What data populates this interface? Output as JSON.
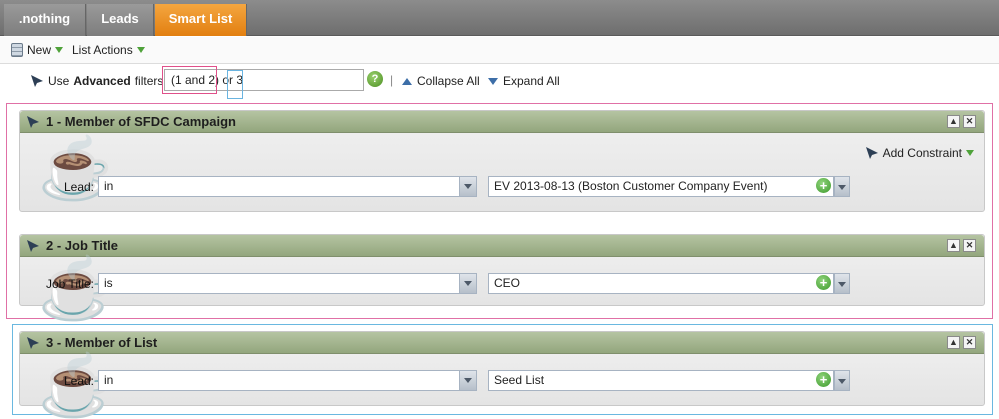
{
  "tabs": [
    {
      "label": ".nothing"
    },
    {
      "label": "Leads"
    },
    {
      "label": "Smart List"
    }
  ],
  "toolbar": {
    "new_label": "New",
    "list_actions_label": "List Actions"
  },
  "logic": {
    "use_prefix": "Use ",
    "use_bold": "Advanced",
    "use_suffix": " filters",
    "expression_part1": "(1 and 2)",
    "expression_part2": " or ",
    "expression_part3": "3",
    "help_symbol": "?",
    "separator": "|",
    "collapse_all": "Collapse All",
    "expand_all": "Expand All"
  },
  "filters": [
    {
      "title": "1 - Member of SFDC Campaign",
      "add_constraint": "Add Constraint",
      "field_label": "Lead:",
      "operator": "in",
      "value": "EV 2013-08-13 (Boston Customer Company Event)"
    },
    {
      "title": "2 - Job Title",
      "field_label": "Job Title:",
      "operator": "is",
      "value": "CEO"
    },
    {
      "title": "3 - Member of List",
      "field_label": "Lead:",
      "operator": "in",
      "value": "Seed List"
    }
  ],
  "colors": {
    "active_tab": "#e9891f",
    "panel_header": "#9fae8a",
    "highlight_red": "#e070a6",
    "highlight_blue": "#6ab8e0"
  },
  "icons": {
    "collapse": "triangle-up-icon",
    "expand": "triangle-down-icon",
    "filter": "funnel-icon",
    "help": "help-icon",
    "add": "plus-icon"
  }
}
